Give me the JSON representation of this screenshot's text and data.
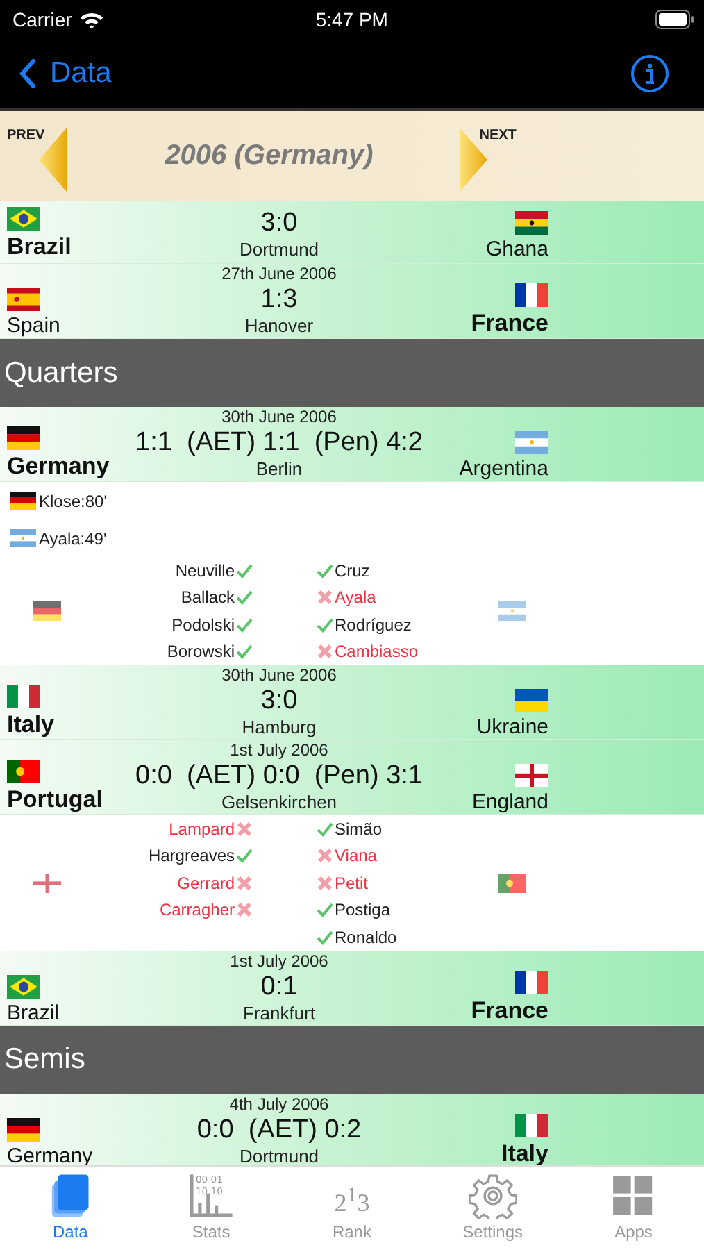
{
  "status_bar": {
    "carrier": "Carrier",
    "time": "5:47 PM"
  },
  "nav": {
    "back": "Data"
  },
  "banner": {
    "prev": "PREV",
    "title": "2006 (Germany)",
    "next": "NEXT"
  },
  "list": [
    {
      "kind": "match",
      "home": {
        "name": "Brazil",
        "kind": "brazil",
        "winner": true
      },
      "away": {
        "name": "Ghana",
        "kind": "ghana",
        "winner": false
      },
      "score": "3:0",
      "venue": "Dortmund"
    },
    {
      "kind": "match",
      "date": "27th June 2006",
      "home": {
        "name": "Spain",
        "kind": "spain",
        "winner": false
      },
      "away": {
        "name": "France",
        "kind": "france",
        "winner": true
      },
      "score": "1:3",
      "venue": "Hanover"
    },
    {
      "kind": "section",
      "title": "Quarters"
    },
    {
      "kind": "match",
      "date": "30th June 2006",
      "home": {
        "name": "Germany",
        "kind": "germany",
        "winner": true
      },
      "away": {
        "name": "Argentina",
        "kind": "argentina",
        "winner": false
      },
      "score": "1:1  (AET) 1:1  (Pen) 4:2",
      "venue": "Berlin",
      "details": {
        "goals": [
          {
            "kind": "germany",
            "text": "Klose:80'"
          },
          {
            "kind": "argentina",
            "text": "Ayala:49'"
          }
        ],
        "left": {
          "kind": "germany",
          "takers": [
            {
              "name": "Neuville",
              "scored": true
            },
            {
              "name": "Ballack",
              "scored": true
            },
            {
              "name": "Podolski",
              "scored": true
            },
            {
              "name": "Borowski",
              "scored": true
            }
          ]
        },
        "right": {
          "kind": "argentina",
          "takers": [
            {
              "name": "Cruz",
              "scored": true
            },
            {
              "name": "Ayala",
              "scored": false
            },
            {
              "name": "Rodríguez",
              "scored": true
            },
            {
              "name": "Cambiasso",
              "scored": false
            }
          ]
        }
      }
    },
    {
      "kind": "match",
      "date": "30th June 2006",
      "home": {
        "name": "Italy",
        "kind": "italy",
        "winner": true
      },
      "away": {
        "name": "Ukraine",
        "kind": "ukraine",
        "winner": false
      },
      "score": "3:0",
      "venue": "Hamburg"
    },
    {
      "kind": "match",
      "date": "1st July 2006",
      "home": {
        "name": "Portugal",
        "kind": "portugal",
        "winner": true
      },
      "away": {
        "name": "England",
        "kind": "england",
        "winner": false
      },
      "score": "0:0  (AET) 0:0  (Pen) 3:1",
      "venue": "Gelsenkirchen",
      "details": {
        "left": {
          "kind": "england",
          "takers": [
            {
              "name": "Lampard",
              "scored": false
            },
            {
              "name": "Hargreaves",
              "scored": true
            },
            {
              "name": "Gerrard",
              "scored": false
            },
            {
              "name": "Carragher",
              "scored": false
            }
          ]
        },
        "right": {
          "kind": "portugal",
          "takers": [
            {
              "name": "Simão",
              "scored": true
            },
            {
              "name": "Viana",
              "scored": false
            },
            {
              "name": "Petit",
              "scored": false
            },
            {
              "name": "Postiga",
              "scored": true
            },
            {
              "name": "Ronaldo",
              "scored": true
            }
          ]
        }
      }
    },
    {
      "kind": "match",
      "date": "1st July 2006",
      "home": {
        "name": "Brazil",
        "kind": "brazil",
        "winner": false
      },
      "away": {
        "name": "France",
        "kind": "france",
        "winner": true
      },
      "score": "0:1",
      "venue": "Frankfurt"
    },
    {
      "kind": "section",
      "title": "Semis"
    },
    {
      "kind": "match",
      "date": "4th July 2006",
      "home": {
        "name": "Germany",
        "kind": "germany",
        "winner": false
      },
      "away": {
        "name": "Italy",
        "kind": "italy",
        "winner": true
      },
      "score": "0:0  (AET) 0:2",
      "venue": "Dortmund"
    }
  ],
  "tabs": [
    {
      "label": "Data",
      "kind": "book",
      "selected": true
    },
    {
      "label": "Stats",
      "kind": "stats",
      "icon_lines": [
        "00 01",
        "10 10"
      ],
      "selected": false
    },
    {
      "label": "Rank",
      "kind": "rank",
      "icon_text": "2$^{1}$3",
      "selected": false
    },
    {
      "label": "Settings",
      "kind": "gear",
      "selected": false
    },
    {
      "label": "Apps",
      "kind": "grid",
      "selected": false
    }
  ]
}
